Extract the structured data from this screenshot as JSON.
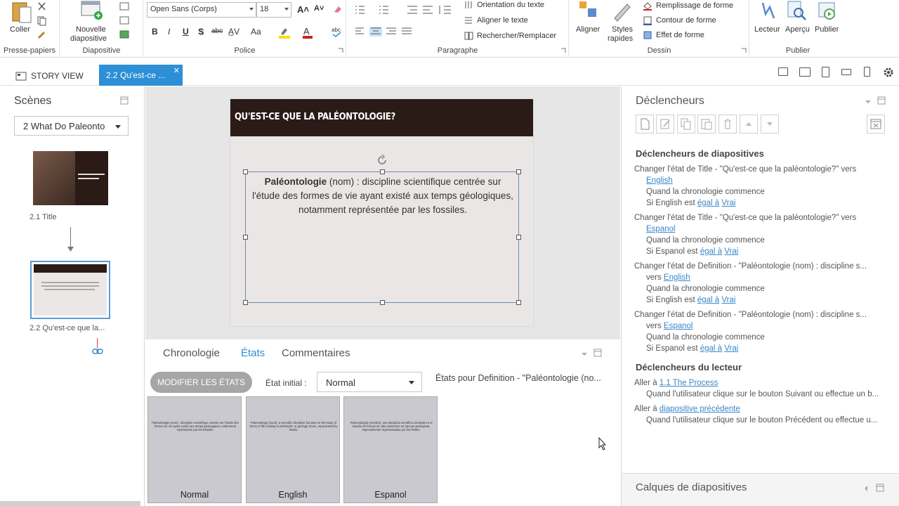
{
  "ribbon": {
    "clipboard": {
      "paste_label": "Coller",
      "group_label": "Presse-papiers"
    },
    "slide": {
      "new_slide_line1": "Nouvelle",
      "new_slide_line2": "diapositive",
      "group_label": "Diapositive"
    },
    "font": {
      "font_name": "Open Sans (Corps)",
      "font_size": "18",
      "group_label": "Police",
      "bold": "B",
      "italic": "I",
      "underline": "U",
      "shadow": "S",
      "strike": "abc",
      "case": "Aa"
    },
    "paragraph": {
      "orientation": "Orientation du texte",
      "align_text": "Aligner le texte",
      "find_replace": "Rechercher/Remplacer",
      "group_label": "Paragraphe"
    },
    "drawing": {
      "align_label": "Aligner",
      "styles_line1": "Styles",
      "styles_line2": "rapides",
      "fill": "Remplissage de forme",
      "outline": "Contour de forme",
      "effect": "Effet de forme",
      "group_label": "Dessin"
    },
    "publish": {
      "player": "Lecteur",
      "preview": "Aperçu",
      "publish": "Publier",
      "group_label": "Publier"
    }
  },
  "tabs": {
    "story_view": "STORY VIEW",
    "active_tab": "2.2 Qu'est-ce ..."
  },
  "scenes": {
    "title": "Scènes",
    "selected_scene": "2 What Do Paleonto",
    "slides": [
      {
        "label": "2.1 Title"
      },
      {
        "label": "2.2 Qu'est-ce que la..."
      }
    ]
  },
  "slide": {
    "header": "QU'EST-CE QUE LA PALÉONTOLOGIE?",
    "term": "Paléontologie",
    "definition": " (nom) : discipline scientifique centrée sur l'étude des formes de vie ayant existé aux temps géologiques, notamment représentée par les fossiles."
  },
  "bottom": {
    "tab_timeline": "Chronologie",
    "tab_states": "États",
    "tab_comments": "Commentaires",
    "modify_states": "MODIFIER LES ÉTATS",
    "initial_state_label": "État initial :",
    "initial_state_value": "Normal",
    "states_for": "États pour Definition - \"Paléontologie (no...",
    "states": [
      {
        "name": "Normal",
        "mini": "Paléontologie (nom) : discipline scientifique centrée sur l'étude des formes de vie ayant existé aux temps géologiques, notamment représentée par les fossiles."
      },
      {
        "name": "English",
        "mini": "Paleontology (noun): a scientific discipline focused on the study of forms of life existing in prehistoric or geologic times, represented by fossils."
      },
      {
        "name": "Espanol",
        "mini": "Paleontología (nombre): una disciplina científica centrada en el estudio de formas de vida existentes en épocas geológicas, especialmente representadas por los fósiles."
      }
    ]
  },
  "triggers": {
    "title": "Déclencheurs",
    "slide_triggers_head": "Déclencheurs de diapositives",
    "t1_line1": "Changer l'état de Title - \"Qu'est-ce que la paléontologie?\" vers",
    "t1_state": "English",
    "t1_when": "Quand la chronologie commence",
    "t1_if_a": "Si English est ",
    "t1_eq": "égal à",
    "t1_val": "Vrai",
    "t2_line1": "Changer l'état de Title - \"Qu'est-ce que la paléontologie?\" vers",
    "t2_state": "Espanol",
    "t2_when": "Quand la chronologie commence",
    "t2_if_a": "Si Espanol est ",
    "t2_eq": "égal à",
    "t2_val": "Vrai",
    "t3_line1": "Changer l'état de Definition - \"Paléontologie (nom) : discipline s...",
    "t3_vers": "vers ",
    "t3_state": "English",
    "t3_when": "Quand la chronologie commence",
    "t3_if_a": "Si English est ",
    "t3_eq": "égal à",
    "t3_val": "Vrai",
    "t4_line1": "Changer l'état de Definition - \"Paléontologie (nom) : discipline s...",
    "t4_vers": "vers ",
    "t4_state": "Espanol",
    "t4_when": "Quand la chronologie commence",
    "t4_if_a": "Si Espanol est ",
    "t4_eq": "égal à",
    "t4_val": "Vrai",
    "player_triggers_head": "Déclencheurs du lecteur",
    "p1_go": "Aller à ",
    "p1_target": "1.1 The Process",
    "p1_when": "Quand l'utilisateur clique sur le bouton Suivant ou effectue un b...",
    "p2_go": "Aller à ",
    "p2_target": "diapositive précédente",
    "p2_when": "Quand l'utilisateur clique sur le bouton Précédent ou effectue u..."
  },
  "layers": {
    "title": "Calques de diapositives"
  },
  "colors": {
    "accent": "#2d8fd5",
    "slide_header": "#2b1b17",
    "link": "#3a86c8"
  }
}
